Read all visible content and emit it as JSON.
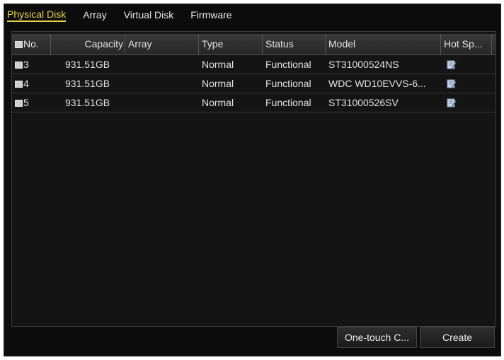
{
  "tabs": [
    "Physical Disk",
    "Array",
    "Virtual Disk",
    "Firmware"
  ],
  "active_tab": "Physical Disk",
  "table": {
    "columns": {
      "no": "No.",
      "capacity": "Capacity",
      "array": "Array",
      "type": "Type",
      "status": "Status",
      "model": "Model",
      "hot_spare": "Hot Sp..."
    },
    "rows": [
      {
        "no": "3",
        "capacity": "931.51GB",
        "array": "",
        "type": "Normal",
        "status": "Functional",
        "model": "ST31000524NS",
        "hot_spare_icon": "edit-icon"
      },
      {
        "no": "4",
        "capacity": "931.51GB",
        "array": "",
        "type": "Normal",
        "status": "Functional",
        "model": "WDC WD10EVVS-6...",
        "hot_spare_icon": "edit-icon"
      },
      {
        "no": "5",
        "capacity": "931.51GB",
        "array": "",
        "type": "Normal",
        "status": "Functional",
        "model": "ST31000526SV",
        "hot_spare_icon": "edit-icon"
      }
    ]
  },
  "buttons": {
    "one_touch": "One-touch C...",
    "create": "Create"
  },
  "colors": {
    "active_tab": "#e8d44a",
    "background": "#0c0c0c"
  }
}
